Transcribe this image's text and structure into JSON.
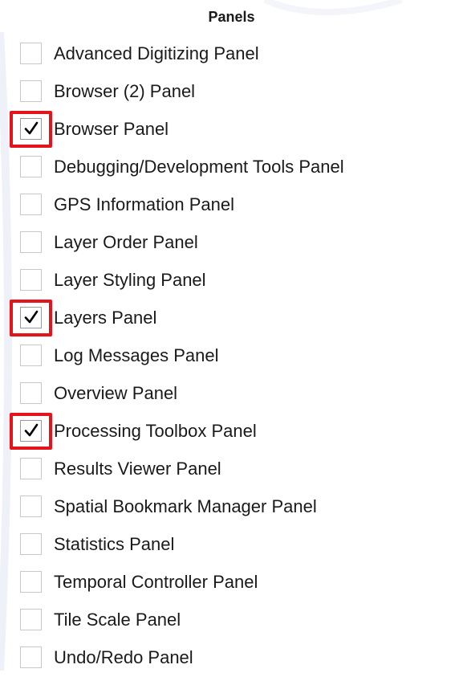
{
  "panel": {
    "title": "Panels"
  },
  "items": [
    {
      "label": "Advanced Digitizing Panel",
      "checked": false,
      "highlighted": false
    },
    {
      "label": "Browser (2) Panel",
      "checked": false,
      "highlighted": false
    },
    {
      "label": "Browser Panel",
      "checked": true,
      "highlighted": true
    },
    {
      "label": "Debugging/Development Tools Panel",
      "checked": false,
      "highlighted": false
    },
    {
      "label": "GPS Information Panel",
      "checked": false,
      "highlighted": false
    },
    {
      "label": "Layer Order Panel",
      "checked": false,
      "highlighted": false
    },
    {
      "label": "Layer Styling Panel",
      "checked": false,
      "highlighted": false
    },
    {
      "label": "Layers Panel",
      "checked": true,
      "highlighted": true
    },
    {
      "label": "Log Messages Panel",
      "checked": false,
      "highlighted": false
    },
    {
      "label": "Overview Panel",
      "checked": false,
      "highlighted": false
    },
    {
      "label": "Processing Toolbox Panel",
      "checked": true,
      "highlighted": true
    },
    {
      "label": "Results Viewer Panel",
      "checked": false,
      "highlighted": false
    },
    {
      "label": "Spatial Bookmark Manager Panel",
      "checked": false,
      "highlighted": false
    },
    {
      "label": "Statistics Panel",
      "checked": false,
      "highlighted": false
    },
    {
      "label": "Temporal Controller Panel",
      "checked": false,
      "highlighted": false
    },
    {
      "label": "Tile Scale Panel",
      "checked": false,
      "highlighted": false
    },
    {
      "label": "Undo/Redo Panel",
      "checked": false,
      "highlighted": false
    }
  ],
  "colors": {
    "highlight": "#e5141b",
    "checkbox_border": "#c8c8c8",
    "text": "#1a1a1a",
    "background": "#ffffff"
  }
}
